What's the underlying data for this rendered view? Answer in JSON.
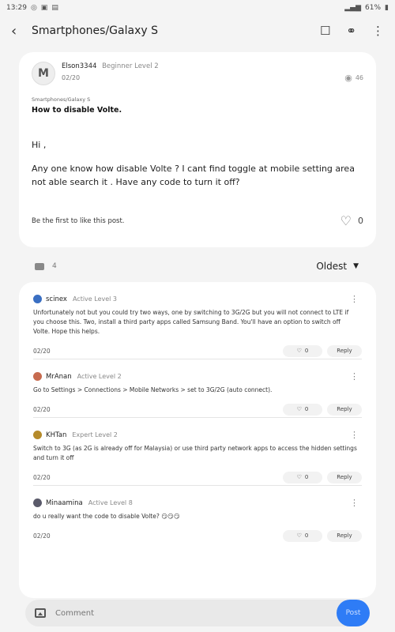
{
  "status": {
    "time": "13:29",
    "battery": "61%"
  },
  "header": {
    "title": "Smartphones/Galaxy S"
  },
  "post": {
    "author": "Elson3344",
    "level": "Beginner Level 2",
    "date": "02/20",
    "views": "46",
    "category": "Smartphones/Galaxy S",
    "title": "How to disable Volte.",
    "greeting": "Hi ,",
    "body": "Any one know how disable Volte ? I cant find toggle at mobile setting area not able search it . Have any code to turn it off?",
    "like_prompt": "Be the first to like this post.",
    "likes": "0"
  },
  "comments_meta": {
    "count": "4",
    "sort": "Oldest"
  },
  "comments": [
    {
      "name": "scinex",
      "level": "Active Level 3",
      "text": "Unfortunately not but you could try two ways, one by switching to 3G/2G but you will not connect to LTE if you choose this. Two, install a third party apps called Samsung Band. You'll have an option to switch off Volte. Hope this helps.",
      "date": "02/20",
      "likes": "0",
      "reply": "Reply",
      "avatar_color": "#3a6fc2"
    },
    {
      "name": "MrAnan",
      "level": "Active Level 2",
      "text": "Go to Settings > Connections > Mobile Networks > set to 3G/2G (auto connect).",
      "date": "02/20",
      "likes": "0",
      "reply": "Reply",
      "avatar_color": "#c76b4f"
    },
    {
      "name": "KHTan",
      "level": "Expert Level 2",
      "text": "Switch to 3G (as 2G is already off for Malaysia) or use third party network apps to access the hidden settings and turn it off",
      "date": "02/20",
      "likes": "0",
      "reply": "Reply",
      "avatar_color": "#b58a2a"
    },
    {
      "name": "Minaamina",
      "level": "Active Level 8",
      "text": "do u really want the code to disable Volte? 😏😏😏",
      "date": "02/20",
      "likes": "0",
      "reply": "Reply",
      "avatar_color": "#5a5a6a"
    }
  ],
  "composer": {
    "placeholder": "Comment",
    "post_label": "Post"
  },
  "icons": {
    "back": "back-arrow-icon",
    "bookmark": "bookmark-icon",
    "share": "share-icon",
    "more": "more-vertical-icon",
    "views": "eye-icon",
    "like": "heart-icon",
    "comment": "chat-icon",
    "image": "image-icon"
  }
}
